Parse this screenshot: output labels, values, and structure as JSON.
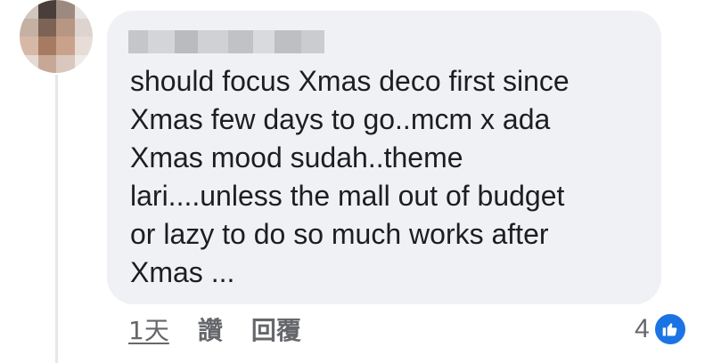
{
  "comment": {
    "text": "should focus Xmas deco first since\nXmas few days to go..mcm x ada\nXmas mood sudah..theme\nlari....unless the mall out of budget\nor lazy to do so much works after\nXmas ..."
  },
  "actions": {
    "time": "1天",
    "like_label": "讚",
    "reply_label": "回覆"
  },
  "reactions": {
    "count": "4",
    "icon": "thumbs-up-icon",
    "color": "#1b74e4"
  }
}
